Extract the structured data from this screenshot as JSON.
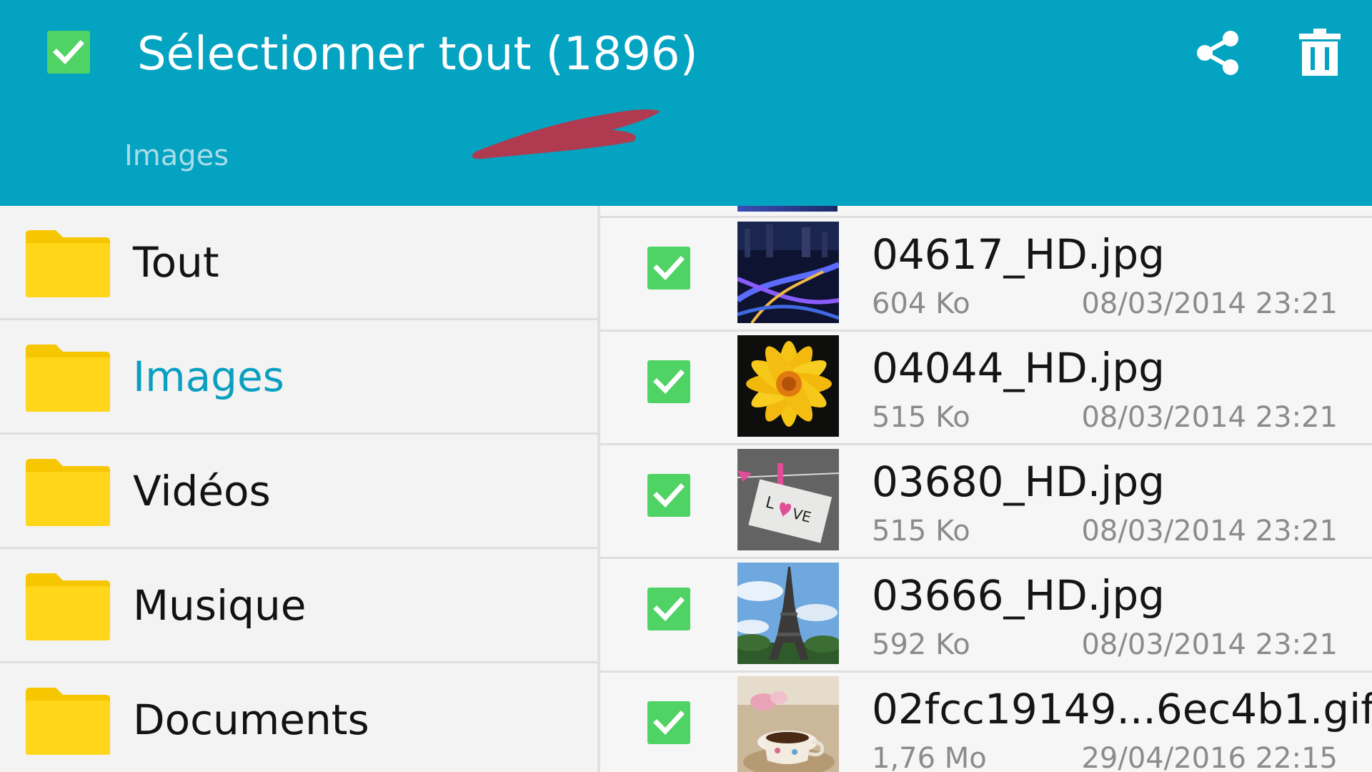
{
  "header": {
    "title": "Sélectionner tout (1896)",
    "breadcrumb": "Images",
    "select_all_checked": true,
    "actions": [
      {
        "icon": "share-icon"
      },
      {
        "icon": "trash-icon"
      }
    ],
    "accent_color": "#04a3c2",
    "check_color": "#4fd364"
  },
  "categories": [
    {
      "label": "Tout",
      "icon": "folder-icon",
      "active": false
    },
    {
      "label": "Images",
      "icon": "folder-icon",
      "active": true
    },
    {
      "label": "Vidéos",
      "icon": "folder-icon",
      "active": false
    },
    {
      "label": "Musique",
      "icon": "folder-icon",
      "active": false
    },
    {
      "label": "Documents",
      "icon": "folder-icon",
      "active": false
    }
  ],
  "files": [
    {
      "name": "04617_HD.jpg",
      "size": "604 Ko",
      "date": "08/03/2014 23:21",
      "checked": true,
      "thumb": "city-highway-night"
    },
    {
      "name": "04044_HD.jpg",
      "size": "515 Ko",
      "date": "08/03/2014 23:21",
      "checked": true,
      "thumb": "yellow-flower"
    },
    {
      "name": "03680_HD.jpg",
      "size": "515 Ko",
      "date": "08/03/2014 23:21",
      "checked": true,
      "thumb": "love-note-clothespin"
    },
    {
      "name": "03666_HD.jpg",
      "size": "592 Ko",
      "date": "08/03/2014 23:21",
      "checked": true,
      "thumb": "eiffel-tower"
    },
    {
      "name": "02fcc19149...6ec4b1.gif",
      "size": "1,76 Mo",
      "date": "29/04/2016 22:15",
      "checked": true,
      "thumb": "coffee-cup-table"
    }
  ]
}
